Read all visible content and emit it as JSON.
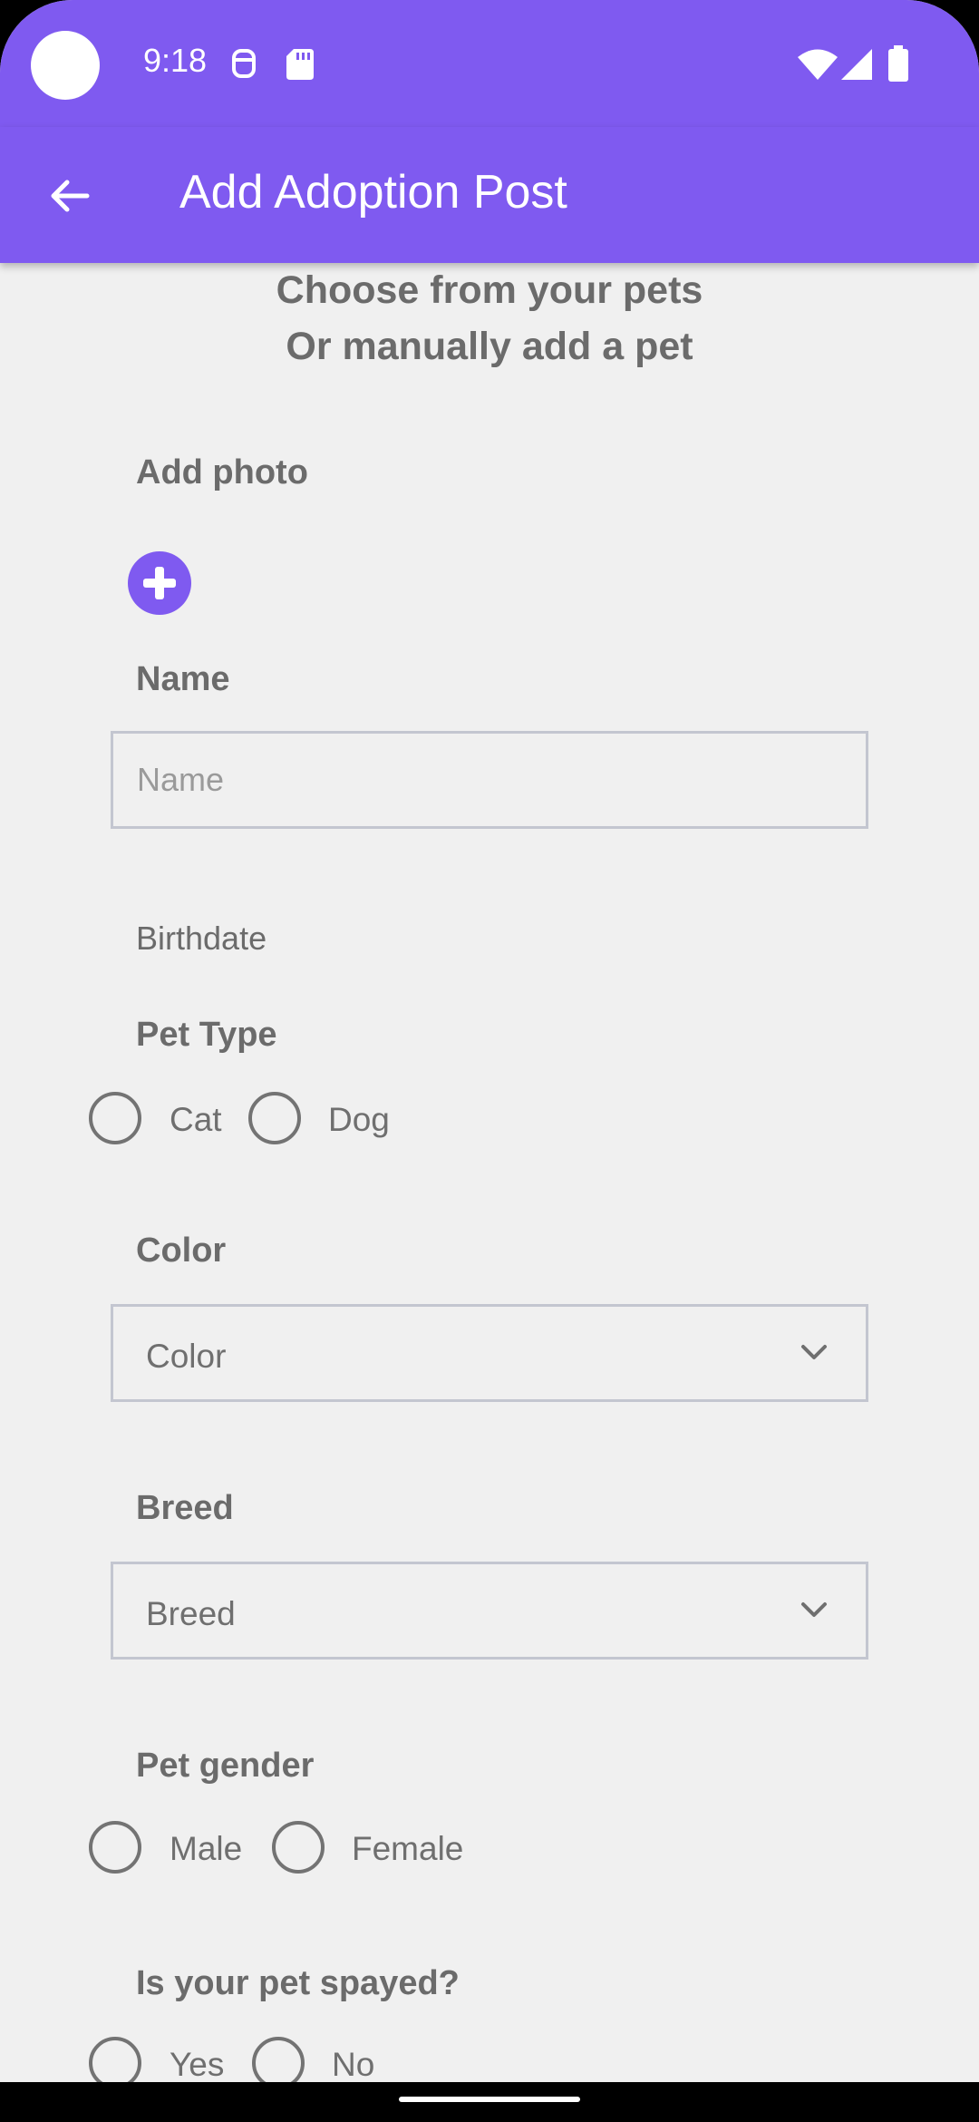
{
  "status_bar": {
    "time": "9:18",
    "icons": [
      "camera-cutout",
      "face-icon",
      "sd-card-icon",
      "wifi-icon",
      "signal-icon",
      "battery-icon"
    ]
  },
  "app_bar": {
    "title": "Add Adoption Post",
    "back_icon": "arrow-back-icon",
    "background_color": "#7f5af0"
  },
  "header": {
    "line1": "Choose from your pets",
    "line2": "Or manually add a pet"
  },
  "form": {
    "add_photo_label": "Add photo",
    "add_photo_icon": "add-circle-icon",
    "name_label": "Name",
    "name_placeholder": "Name",
    "name_value": "",
    "birthdate_label": "Birthdate",
    "pet_type_label": "Pet Type",
    "pet_type_options": [
      "Cat",
      "Dog"
    ],
    "color_label": "Color",
    "color_selected": "Color",
    "breed_label": "Breed",
    "breed_selected": "Breed",
    "gender_label": "Pet gender",
    "gender_options": [
      "Male",
      "Female"
    ],
    "spayed_label": "Is your pet spayed?",
    "spayed_options": [
      "Yes",
      "No"
    ]
  },
  "colors": {
    "accent": "#7f5af0",
    "text_muted": "#6b6b6b",
    "field_border": "#c3c6d0",
    "background": "#f0f0f0"
  }
}
